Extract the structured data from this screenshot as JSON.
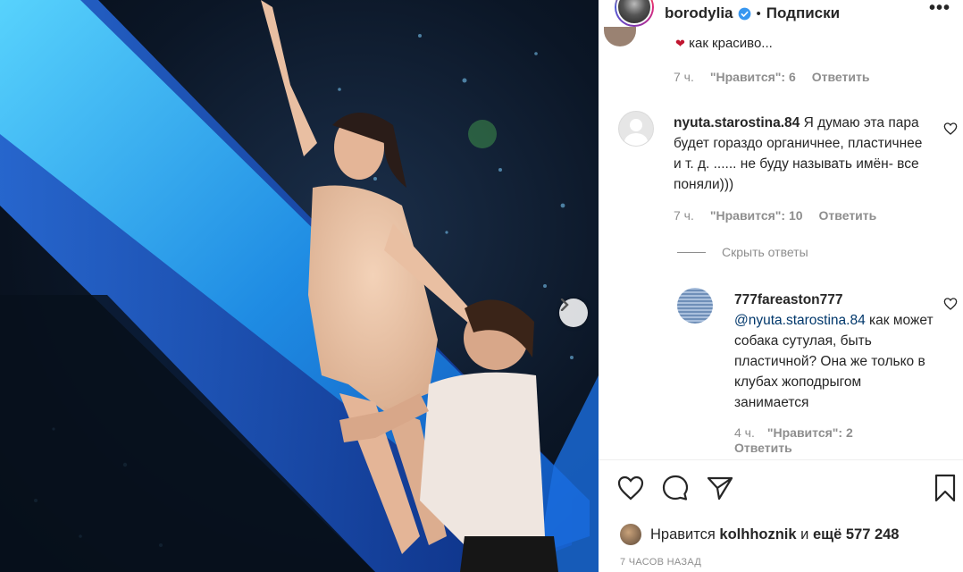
{
  "post": {
    "username": "borodylia",
    "separator": "•",
    "follow_label": "Подписки",
    "more_label": "•••"
  },
  "comments": {
    "cut_comment": {
      "text": "как красиво...",
      "time": "7 ч.",
      "likes": "\"Нравится\": 6",
      "reply": "Ответить"
    },
    "comment2": {
      "username": "nyuta.starostina.84",
      "text": "Я думаю эта пара будет гораздо органичнее, пластичнее и т. д. ...... не буду называть имён- все поняли)))",
      "time": "7 ч.",
      "likes": "\"Нравится\": 10",
      "reply": "Ответить"
    },
    "hide_replies": "Скрыть ответы",
    "reply1": {
      "username": "777fareaston777",
      "mention": "@nyuta.starostina.84",
      "text": "как может собака сутулая, быть пластичной? Она же только в клубах жоподрыгом занимается",
      "time": "4 ч.",
      "likes": "\"Нравится\": 2",
      "reply": "Ответить"
    }
  },
  "footer": {
    "likes_prefix": "Нравится",
    "likes_user": "kolhhoznik",
    "likes_and": "и",
    "likes_more": "ещё 577 248",
    "time_ago": "7 ЧАСОВ НАЗАД"
  },
  "icons": {
    "next": "chevron-right-icon",
    "like": "heart-icon",
    "comment": "comment-icon",
    "share": "send-icon",
    "save": "bookmark-icon",
    "verified": "verified-badge-icon"
  },
  "colors": {
    "verified": "#3897f0",
    "link": "#00376b",
    "muted": "#8e8e8e"
  }
}
